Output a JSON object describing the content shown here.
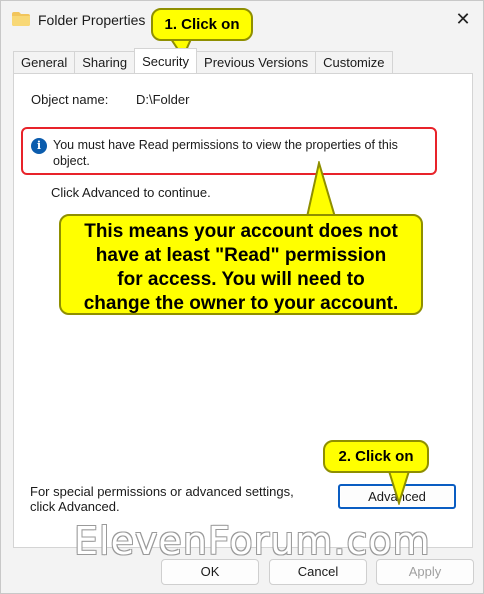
{
  "window": {
    "title": "Folder Properties",
    "close_glyph": "✕"
  },
  "tabs": [
    {
      "label": "General"
    },
    {
      "label": "Sharing"
    },
    {
      "label": "Security"
    },
    {
      "label": "Previous Versions"
    },
    {
      "label": "Customize"
    }
  ],
  "active_tab": "Security",
  "object": {
    "label": "Object name:",
    "value": "D:\\Folder"
  },
  "info": {
    "icon": "info-icon",
    "text": "You must have Read permissions to view the properties of this object."
  },
  "continue_text": "Click Advanced to continue.",
  "special": {
    "text": "For special permissions or advanced settings, click Advanced.",
    "advanced_label": "Advanced"
  },
  "buttons": {
    "ok": "OK",
    "cancel": "Cancel",
    "apply": "Apply"
  },
  "callouts": {
    "step1": "1. Click on",
    "step2": "2. Click on",
    "main_lines": [
      "This means your account does not",
      "have at least \"Read\" permission",
      "for access. You will need to",
      "change the owner to your account."
    ]
  },
  "watermark": "ElevenForum.com",
  "colors": {
    "callout_fill": "#ffff00",
    "highlight_border": "#e8232a",
    "focus_border": "#0a5dc2",
    "info_icon": "#0b5cad"
  }
}
